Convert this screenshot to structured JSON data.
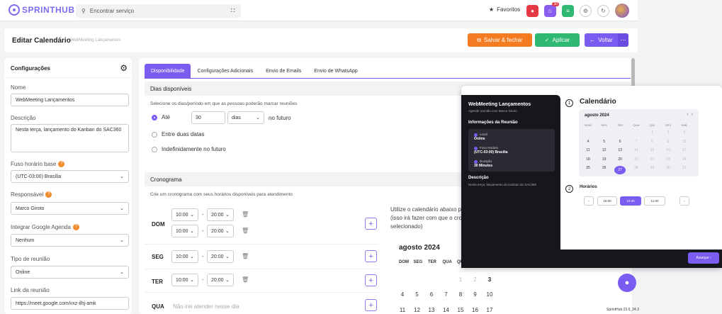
{
  "topbar": {
    "logo": "SPRINTHUB",
    "search_placeholder": "Encontrar serviço",
    "favorites": "Favoritos",
    "notif_badge": "30"
  },
  "titlebar": {
    "title": "Editar Calendário",
    "subtitle": "WebMeeting Lançamentos",
    "save_close": "Salvar & fechar",
    "apply": "Aplicar",
    "back": "Voltar"
  },
  "config": {
    "title": "Configurações",
    "name_label": "Nome",
    "name_value": "WebMeeting Lançamentos",
    "desc_label": "Descrição",
    "desc_value": "Nesta terça, lançamento do Kanban do SAC360",
    "tz_label": "Fuso horário base",
    "tz_value": "(UTC-03:00) Brasília",
    "resp_label": "Responsável",
    "resp_value": "Marco Giroto",
    "google_label": "Integrar Google Agenda",
    "google_value": "Nenhum",
    "type_label": "Tipo de reunião",
    "type_value": "Online",
    "link_label": "Link da reunião",
    "link_value": "https://meet.google.com/vxz-ilhj-amk"
  },
  "tabs": [
    "Disponibilidade",
    "Configurações Adicionais",
    "Envio de Emails",
    "Envio de WhatsApp"
  ],
  "availability": {
    "title": "Dias disponíveis",
    "desc": "Selecione os dias/período em que as pessoas poderão marcar reuniões",
    "opt_until": "Até",
    "days_value": "30",
    "days_unit": "dias",
    "future": "no futuro",
    "opt_between": "Entre duas datas",
    "opt_indef": "Indefinidamente no futuro"
  },
  "schedule": {
    "title": "Cronograma",
    "desc": "Crie um cronograma com seus horários disponíveis para atendimento",
    "days": [
      {
        "label": "DOM",
        "slots": [
          [
            "10:00",
            "20:00"
          ],
          [
            "10:00",
            "20:00"
          ]
        ]
      },
      {
        "label": "SEG",
        "slots": [
          [
            "10:00",
            "20:00"
          ]
        ]
      },
      {
        "label": "TER",
        "slots": [
          [
            "10:00",
            "20:00"
          ]
        ]
      },
      {
        "label": "QUA",
        "slots": []
      }
    ],
    "unavailable": "Não irei atender nesse dia",
    "cal_hint_1": "Utilize o calendário abaixo p",
    "cal_hint_2": "(isso irá fazer com que o cron",
    "cal_hint_3": "selecionado)",
    "cal_month": "agosto 2024",
    "weekdays": [
      "DOM",
      "SEG",
      "TER",
      "QUA",
      "QUI",
      "SEX",
      "SAB"
    ],
    "week1": [
      "1",
      "2",
      "3"
    ],
    "week2": [
      "4",
      "5",
      "6",
      "7",
      "8",
      "9",
      "10"
    ],
    "week3": [
      "11",
      "12",
      "13",
      "14",
      "15",
      "16",
      "17"
    ]
  },
  "preview": {
    "name": "WebMeeting Lançamentos",
    "by": "Agende reunião com Marco Giroto",
    "info_title": "Informações da Reunião",
    "local_label": "Local",
    "local_value": "Online",
    "tz_label": "Fuso Horário",
    "tz_value": "(UTC-03:00) Brasília",
    "dur_label": "Duração",
    "dur_value": "30 Minutos",
    "desc_title": "Descrição",
    "desc_value": "Nesta terça, lançamento do Kanban do SAC360",
    "step1": "1",
    "step2": "2",
    "cal_title": "Calendário",
    "cal_month": "agosto 2024",
    "weekdays": [
      "DOM",
      "SEG",
      "TER",
      "QUA",
      "QUI",
      "SEX",
      "SAB"
    ],
    "rows": [
      [
        "",
        "",
        "",
        "",
        "1",
        "2",
        "3"
      ],
      [
        "4",
        "5",
        "6",
        "7",
        "8",
        "9",
        "10"
      ],
      [
        "11",
        "12",
        "13",
        "14",
        "15",
        "16",
        "17"
      ],
      [
        "18",
        "19",
        "20",
        "21",
        "22",
        "23",
        "24"
      ],
      [
        "25",
        "26",
        "27",
        "28",
        "29",
        "30",
        "31"
      ]
    ],
    "selected_day": "27",
    "hours_title": "Horários",
    "slots": [
      "10:00",
      "10:30",
      "11:00"
    ],
    "selected_slot": "10:30",
    "next": "Avançar"
  },
  "version": "SprintHub 23.6_24.3"
}
